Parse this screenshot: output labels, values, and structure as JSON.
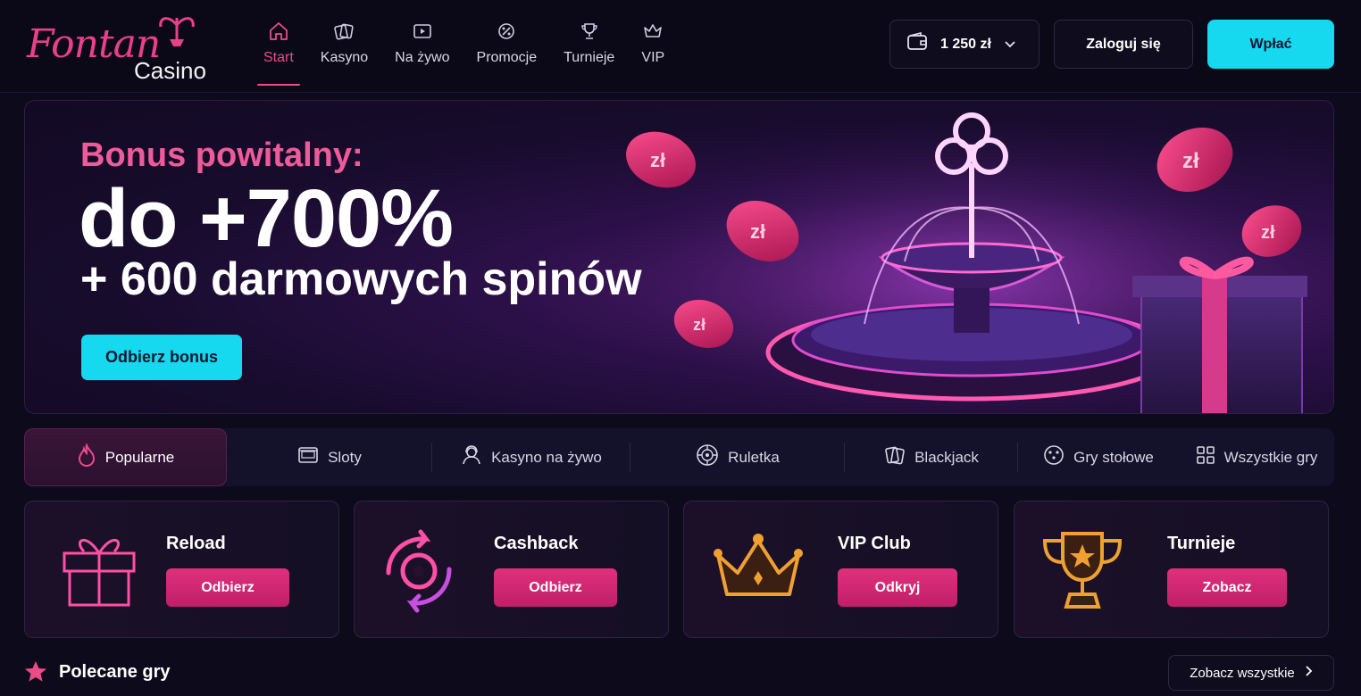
{
  "brand": {
    "name": "Fontan",
    "sub": "Casino"
  },
  "nav": {
    "items": [
      {
        "label": "Start",
        "icon": "home-icon",
        "active": true
      },
      {
        "label": "Kasyno",
        "icon": "cards-icon"
      },
      {
        "label": "Na żywo",
        "icon": "live-icon"
      },
      {
        "label": "Promocje",
        "icon": "promo-icon"
      },
      {
        "label": "Turnieje",
        "icon": "trophy-icon"
      },
      {
        "label": "VIP",
        "icon": "crown-icon"
      }
    ]
  },
  "header": {
    "balance": "1 250 zł",
    "login_label": "Zaloguj się",
    "deposit_label": "Wpłać"
  },
  "hero": {
    "eyebrow": "Bonus powitalny:",
    "headline": "do +700%",
    "subline": "+ 600 darmowych spinów",
    "cta_label": "Odbierz bonus",
    "coin_label": "zł"
  },
  "categories": [
    {
      "label": "Popularne",
      "icon": "flame-icon",
      "active": true
    },
    {
      "label": "Sloty",
      "icon": "slot-icon"
    },
    {
      "label": "Kasyno na żywo",
      "icon": "dealer-icon"
    },
    {
      "label": "Ruletka",
      "icon": "roulette-icon"
    },
    {
      "label": "Blackjack",
      "icon": "blackjack-icon"
    },
    {
      "label": "Gry stołowe",
      "icon": "table-game-icon"
    },
    {
      "label": "Wszystkie gry",
      "icon": "grid-icon"
    }
  ],
  "promos": [
    {
      "title": "Reload",
      "button": "Odbierz",
      "icon": "gift-icon"
    },
    {
      "title": "Cashback",
      "button": "Odbierz",
      "icon": "cashback-icon"
    },
    {
      "title": "VIP Club",
      "button": "Odkryj",
      "icon": "crown-icon"
    },
    {
      "title": "Turnieje",
      "button": "Zobacz",
      "icon": "trophy-icon"
    }
  ],
  "featured": {
    "title": "Polecane gry",
    "see_all": "Zobacz wszystkie"
  },
  "colors": {
    "accent_pink": "#ea4c89",
    "accent_cyan": "#16d8ef",
    "background": "#0d0a1c"
  }
}
